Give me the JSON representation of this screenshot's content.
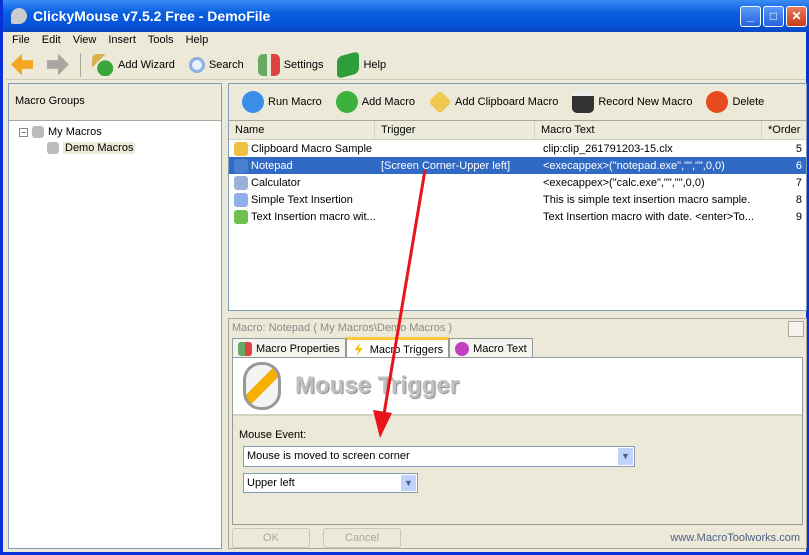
{
  "window": {
    "title": "ClickyMouse v7.5.2 Free - DemoFile"
  },
  "menu": [
    "File",
    "Edit",
    "View",
    "Insert",
    "Tools",
    "Help"
  ],
  "toolbar": {
    "add_wizard": "Add Wizard",
    "search": "Search",
    "settings": "Settings",
    "help": "Help"
  },
  "left": {
    "header": "Macro Groups",
    "tree": [
      "My Macros",
      "Demo Macros"
    ]
  },
  "macro_toolbar": {
    "run": "Run Macro",
    "add": "Add Macro",
    "add_clip": "Add Clipboard Macro",
    "record": "Record New Macro",
    "delete": "Delete"
  },
  "list": {
    "columns": [
      "Name",
      "Trigger",
      "Macro Text",
      "*Order"
    ],
    "rows": [
      {
        "name": "Clipboard Macro Sample",
        "trigger": "",
        "text": "clip:clip_261791203-15.clx",
        "order": "5",
        "color": "#f0c040"
      },
      {
        "name": "Notepad",
        "trigger": "[Screen Corner-Upper left]",
        "text": "<execappex>(\"notepad.exe\",\"\",\"\",0,0)",
        "order": "6",
        "color": "#4a7fd0"
      },
      {
        "name": "Calculator",
        "trigger": "",
        "text": "<execappex>(\"calc.exe\",\"\",\"\",0,0)",
        "order": "7",
        "color": "#9ab0d8"
      },
      {
        "name": "Simple Text Insertion",
        "trigger": "",
        "text": "This is simple text insertion macro sample.",
        "order": "8",
        "color": "#8fb0e8"
      },
      {
        "name": "Text Insertion macro wit...",
        "trigger": "",
        "text": "Text Insertion macro with date. <enter>To...",
        "order": "9",
        "color": "#70c050"
      }
    ]
  },
  "detail": {
    "title": "Macro: Notepad ( My Macros\\Demo Macros )",
    "tabs": [
      "Macro Properties",
      "Macro Triggers",
      "Macro Text"
    ],
    "banner": "Mouse Trigger",
    "mouse_event_label": "Mouse Event:",
    "event_value": "Mouse is moved to screen corner",
    "corner_value": "Upper left",
    "ok": "OK",
    "cancel": "Cancel",
    "url": "www.MacroToolworks.com"
  }
}
